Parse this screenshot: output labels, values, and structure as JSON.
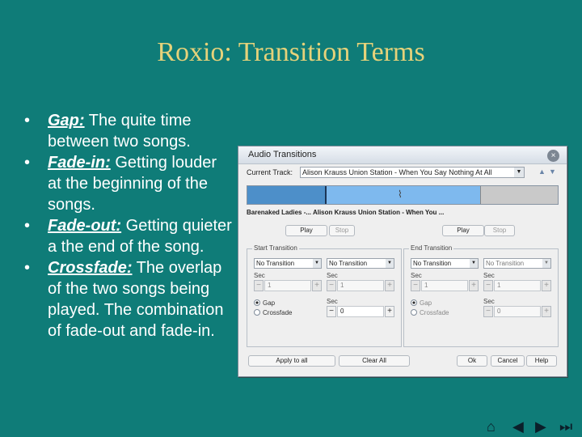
{
  "slide": {
    "title": "Roxio: Transition Terms",
    "bullets": [
      {
        "term": "Gap:",
        "text": " The quite time between two songs."
      },
      {
        "term": "Fade-in:",
        "text": " Getting louder at the beginning of the songs."
      },
      {
        "term": "Fade-out:",
        "text": " Getting quieter a the end of the song."
      },
      {
        "term": "Crossfade:",
        "text": " The overlap of the two songs being played. The combination of fade-out and fade-in."
      }
    ]
  },
  "dialog": {
    "title": "Audio Transitions",
    "close_icon": "×",
    "current_track_label": "Current Track:",
    "current_track_value": "Alison Krauss  Union Station - When You Say Nothing At All",
    "track_names": "Barenaked Ladies -... Alison Krauss  Union Station - When You ...",
    "left_play": "Play",
    "left_stop": "Stop",
    "right_play": "Play",
    "right_stop": "Stop",
    "start_group": {
      "legend": "Start Transition",
      "left_combo": "No Transition",
      "right_combo": "No Transition",
      "sec1_label": "Sec",
      "sec1_value": "1",
      "sec2_label": "Sec",
      "sec2_value": "1",
      "sec3_label": "Sec",
      "sec3_value": "0",
      "radio_gap": "Gap",
      "radio_crossfade": "Crossfade"
    },
    "end_group": {
      "legend": "End Transition",
      "left_combo": "No Transition",
      "right_combo": "No Transition",
      "sec1_label": "Sec",
      "sec1_value": "1",
      "sec2_label": "Sec",
      "sec2_value": "1",
      "sec3_label": "Sec",
      "sec3_value": "0",
      "radio_gap": "Gap",
      "radio_crossfade": "Crossfade"
    },
    "apply_all": "Apply to all",
    "clear_all": "Clear All",
    "ok": "Ok",
    "cancel": "Cancel",
    "help": "Help"
  },
  "nav": {
    "home_icon": "⌂",
    "prev_icon": "◀",
    "next_icon": "▶",
    "end_icon": "⏭"
  }
}
